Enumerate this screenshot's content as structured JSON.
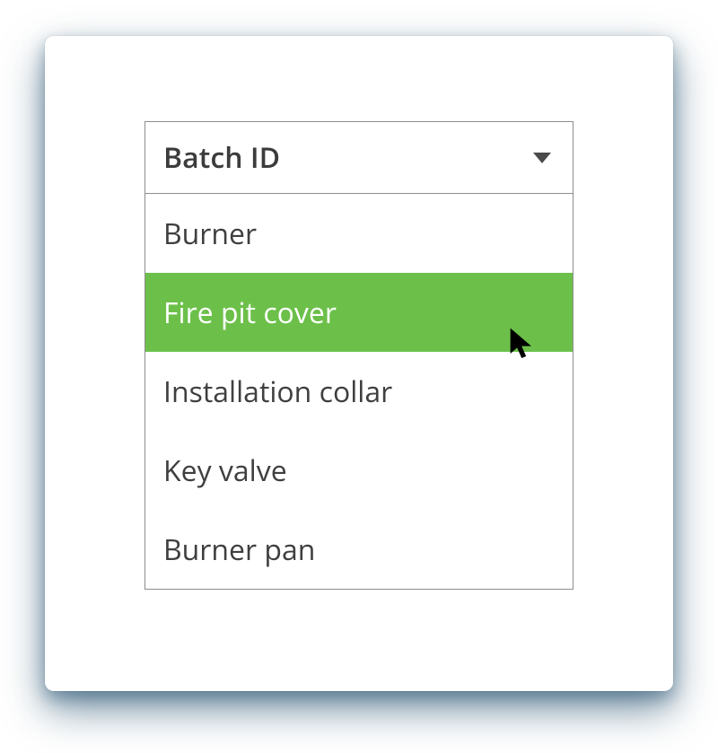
{
  "dropdown": {
    "label": "Batch ID",
    "options": [
      {
        "label": "Burner",
        "highlighted": false
      },
      {
        "label": "Fire pit cover",
        "highlighted": true
      },
      {
        "label": "Installation collar",
        "highlighted": false
      },
      {
        "label": "Key valve",
        "highlighted": false
      },
      {
        "label": "Burner pan",
        "highlighted": false
      }
    ]
  },
  "colors": {
    "highlight": "#6cc04a",
    "panel_shadow": "#0a3a5c",
    "text": "#3c3c3c",
    "border": "#8d8d8d"
  }
}
